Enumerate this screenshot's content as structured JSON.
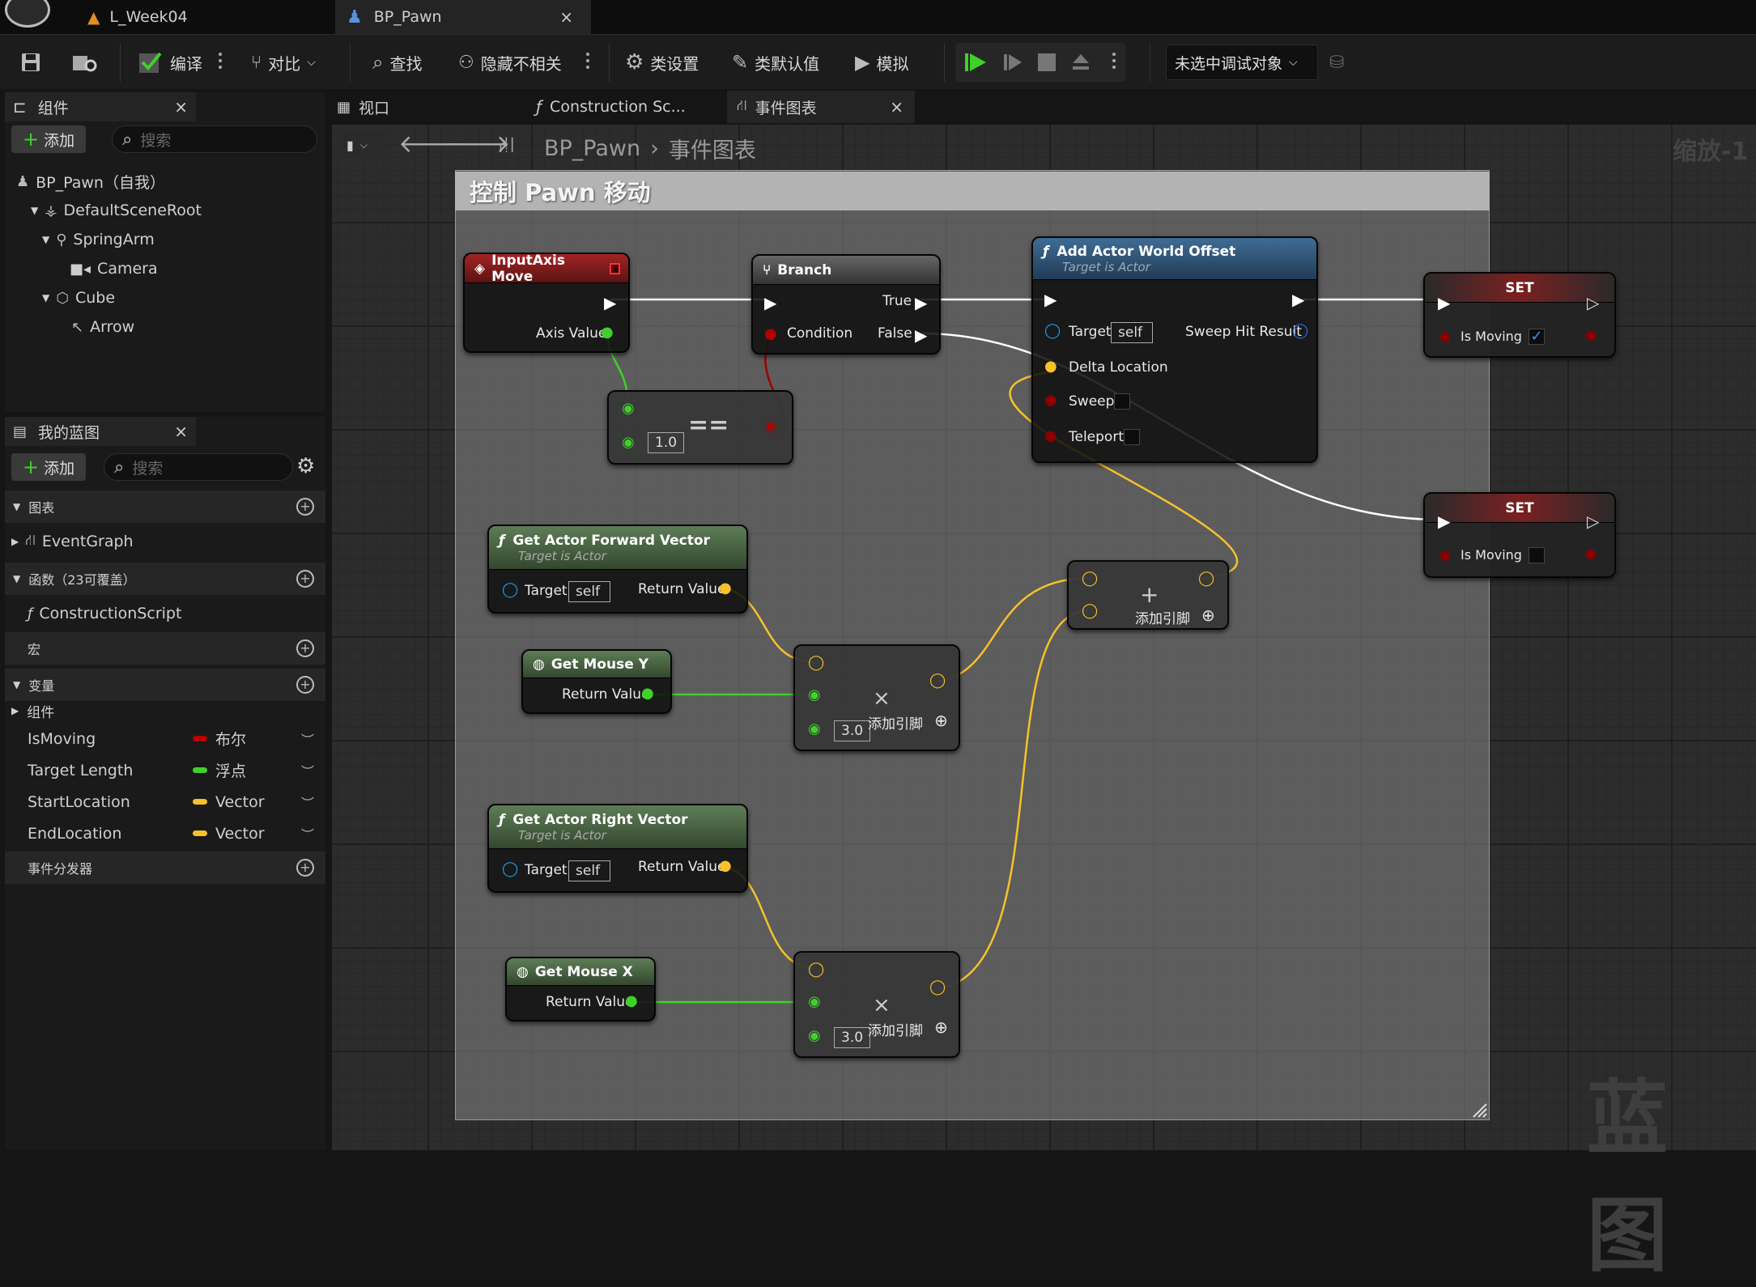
{
  "title_bar": {
    "tabs": [
      {
        "label": "L_Week04"
      },
      {
        "label": "BP_Pawn"
      }
    ]
  },
  "toolbar": {
    "compile": "编译",
    "diff": "对比",
    "find": "查找",
    "hide_unrelated": "隐藏不相关",
    "class_settings": "类设置",
    "class_defaults": "类默认值",
    "simulate": "模拟",
    "debug_target": "未选中调试对象"
  },
  "components_panel": {
    "title": "组件",
    "add": "添加",
    "search_placeholder": "搜索",
    "tree": [
      "BP_Pawn（自我）",
      "DefaultSceneRoot",
      "SpringArm",
      "Camera",
      "Cube",
      "Arrow"
    ]
  },
  "my_blueprint": {
    "title": "我的蓝图",
    "add": "添加",
    "search_placeholder": "搜索",
    "graphs_header": "图表",
    "event_graph": "EventGraph",
    "functions_header": "函数（23可覆盖）",
    "construction_script": "ConstructionScript",
    "macros_header": "宏",
    "variables_header": "变量",
    "components_group": "组件",
    "variables": [
      {
        "name": "IsMoving",
        "type": "布尔",
        "color": "#b80000"
      },
      {
        "name": "Target Length",
        "type": "浮点",
        "color": "#3fd12a"
      },
      {
        "name": "StartLocation",
        "type": "Vector",
        "color": "#f6c12a"
      },
      {
        "name": "EndLocation",
        "type": "Vector",
        "color": "#f6c12a"
      }
    ],
    "dispatchers_header": "事件分发器"
  },
  "graph_tabs": [
    {
      "label": "视口"
    },
    {
      "label": "Construction Sc..."
    },
    {
      "label": "事件图表"
    }
  ],
  "breadcrumb": {
    "root": "BP_Pawn",
    "current": "事件图表"
  },
  "zoom": "缩放-1",
  "watermark": "蓝图",
  "comment": "控制 Pawn 移动",
  "nodes": {
    "input_axis": {
      "title": "InputAxis Move",
      "axis_value": "Axis Value"
    },
    "branch": {
      "title": "Branch",
      "true": "True",
      "false": "False",
      "condition": "Condition"
    },
    "equal": {
      "op": "==",
      "value": "1.0"
    },
    "add_offset": {
      "title": "Add Actor World Offset",
      "subtitle": "Target is Actor",
      "target": "Target",
      "self": "self",
      "sweep_hit": "Sweep Hit Result",
      "delta": "Delta Location",
      "sweep": "Sweep",
      "teleport": "Teleport"
    },
    "set1": {
      "title": "SET",
      "var": "Is Moving",
      "checked": true
    },
    "set2": {
      "title": "SET",
      "var": "Is Moving",
      "checked": false
    },
    "forward": {
      "title": "Get Actor Forward Vector",
      "subtitle": "Target is Actor",
      "target": "Target",
      "self": "self",
      "ret": "Return Value"
    },
    "right": {
      "title": "Get Actor Right Vector",
      "subtitle": "Target is Actor",
      "target": "Target",
      "self": "self",
      "ret": "Return Value"
    },
    "mouse_y": {
      "title": "Get Mouse Y",
      "ret": "Return Value"
    },
    "mouse_x": {
      "title": "Get Mouse X",
      "ret": "Return Value"
    },
    "mul1": {
      "op": "×",
      "value": "3.0",
      "add_pin": "添加引脚"
    },
    "mul2": {
      "op": "×",
      "value": "3.0",
      "add_pin": "添加引脚"
    },
    "add": {
      "op": "+",
      "add_pin": "添加引脚"
    }
  }
}
